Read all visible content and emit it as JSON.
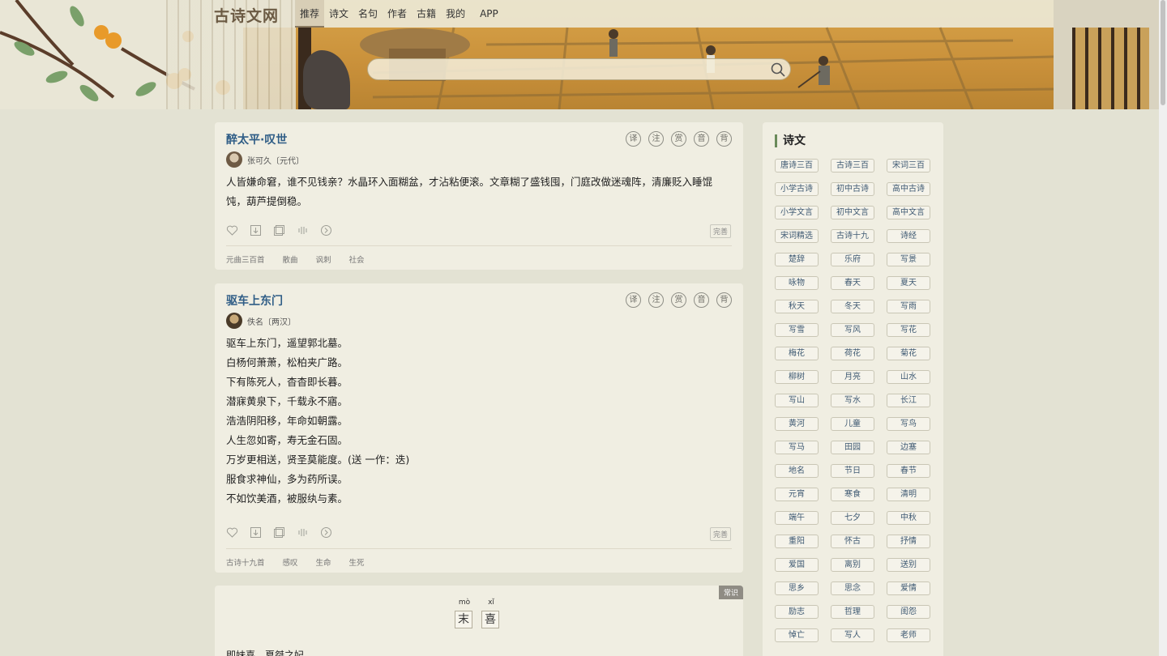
{
  "site": {
    "logo": "古诗文网"
  },
  "nav": {
    "items": [
      "推荐",
      "诗文",
      "名句",
      "作者",
      "古籍",
      "我的"
    ],
    "app": "APP"
  },
  "search": {
    "placeholder": ""
  },
  "poems": [
    {
      "title": "醉太平·叹世",
      "author": "张可久〔元代〕",
      "lines": [
        "人皆嫌命窘，谁不见钱亲？水晶环入面糊盆，才沾粘便滚。文章糊了盛钱囤，门庭改做迷魂阵，清廉贬入睡馄饨，葫芦提倒稳。"
      ],
      "full_label": "完善",
      "tags": [
        "元曲三百首",
        "散曲",
        "讽刺",
        "社会"
      ]
    },
    {
      "title": "驱车上东门",
      "author": "佚名〔两汉〕",
      "lines": [
        "驱车上东门，遥望郭北墓。",
        "白杨何萧萧，松柏夹广路。",
        "下有陈死人，杳杳即长暮。",
        "潜寐黄泉下，千载永不寤。",
        "浩浩阴阳移，年命如朝露。",
        "人生忽如寄，寿无金石固。",
        "万岁更相送，贤圣莫能度。(送 一作：迭)",
        "服食求神仙，多为药所误。",
        "不如饮美酒，被服纨与素。"
      ],
      "full_label": "完善",
      "tags": [
        "古诗十九首",
        "感叹",
        "生命",
        "生死"
      ]
    }
  ],
  "tool_icons": [
    "译",
    "注",
    "赏",
    "音",
    "背"
  ],
  "action_icons": [
    "heart-icon",
    "download-icon",
    "copy-icon",
    "audio-icon",
    "more-icon"
  ],
  "knowledge_card": {
    "badge": "常识",
    "chars": [
      {
        "pinyin": "mò",
        "hanzi": "末"
      },
      {
        "pinyin": "xǐ",
        "hanzi": "喜"
      }
    ],
    "snippet": "即妹喜，夏桀之妃"
  },
  "sidebar": {
    "title": "诗文",
    "categories": [
      "唐诗三百",
      "古诗三百",
      "宋词三百",
      "小学古诗",
      "初中古诗",
      "高中古诗",
      "小学文言",
      "初中文言",
      "高中文言",
      "宋词精选",
      "古诗十九",
      "诗经",
      "楚辞",
      "乐府",
      "写景",
      "咏物",
      "春天",
      "夏天",
      "秋天",
      "冬天",
      "写雨",
      "写雪",
      "写风",
      "写花",
      "梅花",
      "荷花",
      "菊花",
      "柳树",
      "月亮",
      "山水",
      "写山",
      "写水",
      "长江",
      "黄河",
      "儿童",
      "写鸟",
      "写马",
      "田园",
      "边塞",
      "地名",
      "节日",
      "春节",
      "元宵",
      "寒食",
      "清明",
      "端午",
      "七夕",
      "中秋",
      "重阳",
      "怀古",
      "抒情",
      "爱国",
      "离别",
      "送别",
      "思乡",
      "思念",
      "爱情",
      "励志",
      "哲理",
      "闺怨",
      "悼亡",
      "写人",
      "老师"
    ]
  },
  "colors": {
    "link": "#2f5d86",
    "page_bg": "#e3e2d3",
    "card_bg": "#f0eee2"
  }
}
